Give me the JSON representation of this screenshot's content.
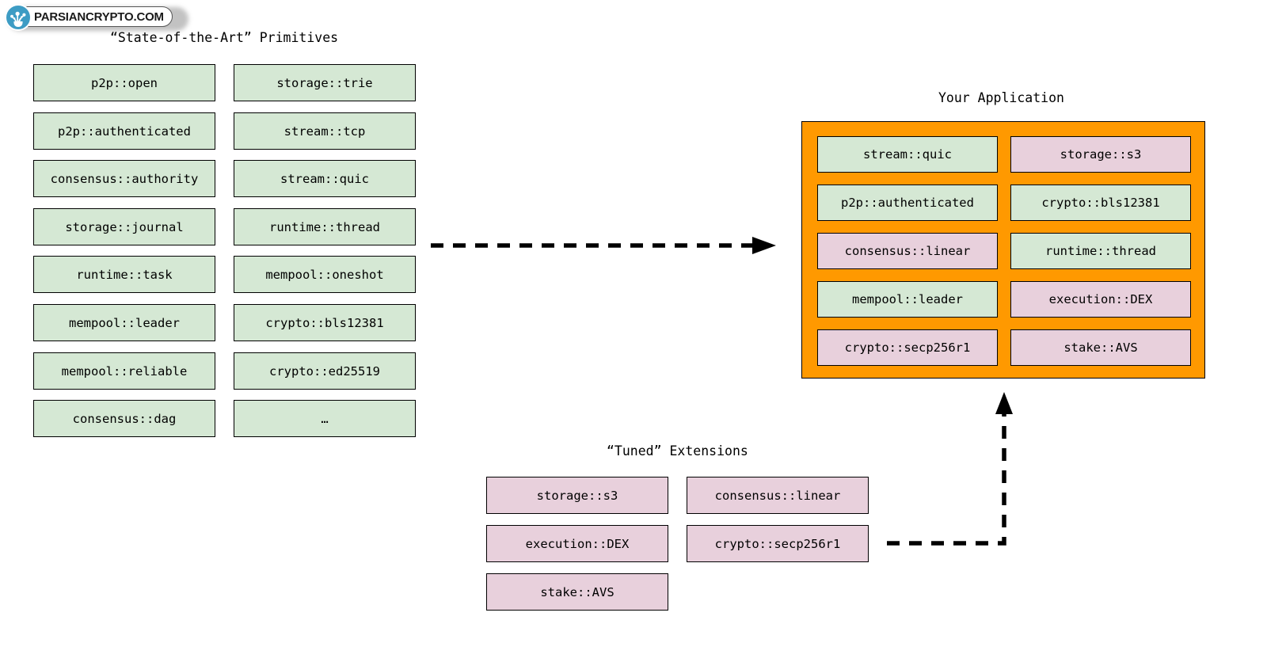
{
  "watermark": {
    "brand_text": "PARSIANCRYPTO.COM",
    "icon": "sprout-network-icon",
    "circle_color": "#3d9cc4"
  },
  "colors": {
    "primitive_green": "#d5e8d4",
    "extension_pink": "#e8d0dc",
    "application_orange": "#ff9900",
    "border_black": "#000000"
  },
  "primitives": {
    "title": "“State-of-the-Art” Primitives",
    "column_a": [
      "p2p::open",
      "p2p::authenticated",
      "consensus::authority",
      "storage::journal",
      "runtime::task",
      "mempool::leader",
      "mempool::reliable",
      "consensus::dag"
    ],
    "column_b": [
      "storage::trie",
      "stream::tcp",
      "stream::quic",
      "runtime::thread",
      "mempool::oneshot",
      "crypto::bls12381",
      "crypto::ed25519",
      "…"
    ]
  },
  "application": {
    "title": "Your Application",
    "column_a": [
      {
        "label": "stream::quic",
        "kind": "green"
      },
      {
        "label": "p2p::authenticated",
        "kind": "green"
      },
      {
        "label": "consensus::linear",
        "kind": "pink"
      },
      {
        "label": "mempool::leader",
        "kind": "green"
      },
      {
        "label": "crypto::secp256r1",
        "kind": "pink"
      }
    ],
    "column_b": [
      {
        "label": "storage::s3",
        "kind": "pink"
      },
      {
        "label": "crypto::bls12381",
        "kind": "green"
      },
      {
        "label": "runtime::thread",
        "kind": "green"
      },
      {
        "label": "execution::DEX",
        "kind": "pink"
      },
      {
        "label": "stake::AVS",
        "kind": "pink"
      }
    ]
  },
  "extensions": {
    "title": "“Tuned” Extensions",
    "column_a": [
      "storage::s3",
      "execution::DEX",
      "stake::AVS"
    ],
    "column_b": [
      "consensus::linear",
      "crypto::secp256r1"
    ]
  },
  "arrows": [
    {
      "name": "primitives-to-application",
      "style": "dashed",
      "direction": "right"
    },
    {
      "name": "extensions-to-application",
      "style": "dashed",
      "direction": "up"
    }
  ]
}
